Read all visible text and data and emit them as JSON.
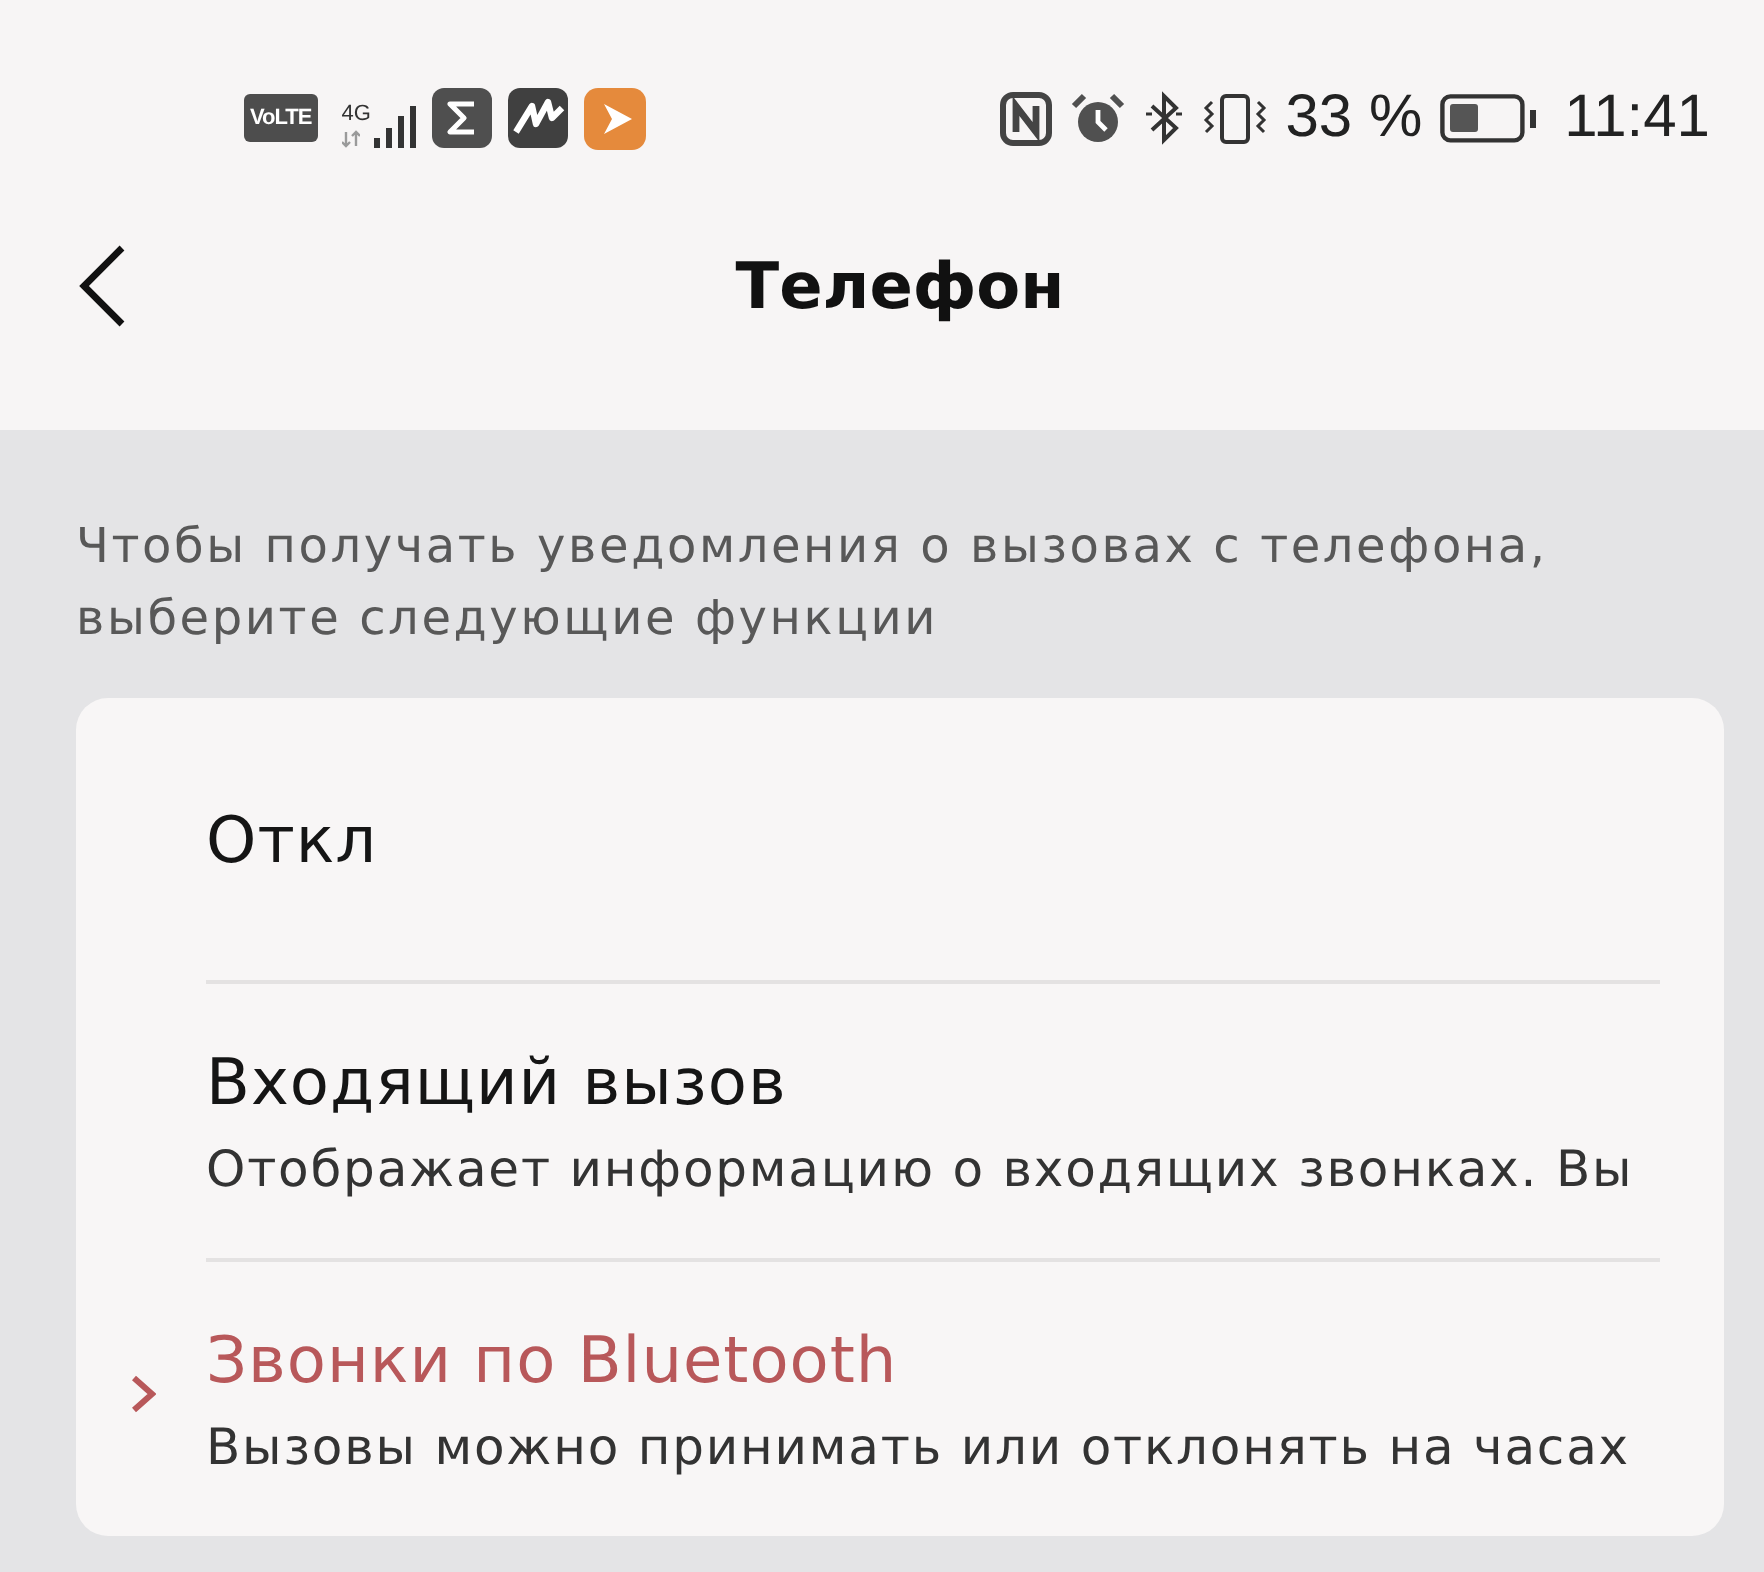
{
  "status_bar": {
    "network_badge": "VoLTE",
    "network_type": "4G",
    "battery_percent": "33 %",
    "time": "11:41"
  },
  "header": {
    "title": "Телефон"
  },
  "description": "Чтобы получать уведомления о вызовах с телефона, выберите следующие функции",
  "options": [
    {
      "title": "Откл",
      "selected": false
    },
    {
      "title": "Входящий вызов",
      "subtitle": "Отображает информацию о входящих звонках. Вы",
      "selected": false
    },
    {
      "title": "Звонки по Bluetooth",
      "subtitle": "Вызовы можно принимать или отклонять на часах",
      "selected": true
    }
  ]
}
